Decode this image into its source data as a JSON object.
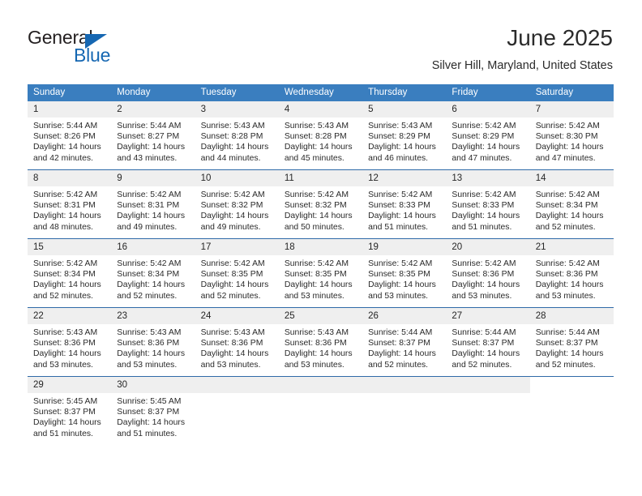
{
  "brand": {
    "name_top": "General",
    "name_bottom": "Blue",
    "accent_color": "#1667b2"
  },
  "header": {
    "title": "June 2025",
    "subtitle": "Silver Hill, Maryland, United States"
  },
  "calendar": {
    "header_background": "#3a7ebf",
    "daynum_background": "#efefef",
    "rule_color": "#2f6aa8",
    "weekday_headers": [
      "Sunday",
      "Monday",
      "Tuesday",
      "Wednesday",
      "Thursday",
      "Friday",
      "Saturday"
    ],
    "weeks": [
      [
        {
          "day": "1",
          "sunrise": "Sunrise: 5:44 AM",
          "sunset": "Sunset: 8:26 PM",
          "daylight_line1": "Daylight: 14 hours",
          "daylight_line2": "and 42 minutes."
        },
        {
          "day": "2",
          "sunrise": "Sunrise: 5:44 AM",
          "sunset": "Sunset: 8:27 PM",
          "daylight_line1": "Daylight: 14 hours",
          "daylight_line2": "and 43 minutes."
        },
        {
          "day": "3",
          "sunrise": "Sunrise: 5:43 AM",
          "sunset": "Sunset: 8:28 PM",
          "daylight_line1": "Daylight: 14 hours",
          "daylight_line2": "and 44 minutes."
        },
        {
          "day": "4",
          "sunrise": "Sunrise: 5:43 AM",
          "sunset": "Sunset: 8:28 PM",
          "daylight_line1": "Daylight: 14 hours",
          "daylight_line2": "and 45 minutes."
        },
        {
          "day": "5",
          "sunrise": "Sunrise: 5:43 AM",
          "sunset": "Sunset: 8:29 PM",
          "daylight_line1": "Daylight: 14 hours",
          "daylight_line2": "and 46 minutes."
        },
        {
          "day": "6",
          "sunrise": "Sunrise: 5:42 AM",
          "sunset": "Sunset: 8:29 PM",
          "daylight_line1": "Daylight: 14 hours",
          "daylight_line2": "and 47 minutes."
        },
        {
          "day": "7",
          "sunrise": "Sunrise: 5:42 AM",
          "sunset": "Sunset: 8:30 PM",
          "daylight_line1": "Daylight: 14 hours",
          "daylight_line2": "and 47 minutes."
        }
      ],
      [
        {
          "day": "8",
          "sunrise": "Sunrise: 5:42 AM",
          "sunset": "Sunset: 8:31 PM",
          "daylight_line1": "Daylight: 14 hours",
          "daylight_line2": "and 48 minutes."
        },
        {
          "day": "9",
          "sunrise": "Sunrise: 5:42 AM",
          "sunset": "Sunset: 8:31 PM",
          "daylight_line1": "Daylight: 14 hours",
          "daylight_line2": "and 49 minutes."
        },
        {
          "day": "10",
          "sunrise": "Sunrise: 5:42 AM",
          "sunset": "Sunset: 8:32 PM",
          "daylight_line1": "Daylight: 14 hours",
          "daylight_line2": "and 49 minutes."
        },
        {
          "day": "11",
          "sunrise": "Sunrise: 5:42 AM",
          "sunset": "Sunset: 8:32 PM",
          "daylight_line1": "Daylight: 14 hours",
          "daylight_line2": "and 50 minutes."
        },
        {
          "day": "12",
          "sunrise": "Sunrise: 5:42 AM",
          "sunset": "Sunset: 8:33 PM",
          "daylight_line1": "Daylight: 14 hours",
          "daylight_line2": "and 51 minutes."
        },
        {
          "day": "13",
          "sunrise": "Sunrise: 5:42 AM",
          "sunset": "Sunset: 8:33 PM",
          "daylight_line1": "Daylight: 14 hours",
          "daylight_line2": "and 51 minutes."
        },
        {
          "day": "14",
          "sunrise": "Sunrise: 5:42 AM",
          "sunset": "Sunset: 8:34 PM",
          "daylight_line1": "Daylight: 14 hours",
          "daylight_line2": "and 52 minutes."
        }
      ],
      [
        {
          "day": "15",
          "sunrise": "Sunrise: 5:42 AM",
          "sunset": "Sunset: 8:34 PM",
          "daylight_line1": "Daylight: 14 hours",
          "daylight_line2": "and 52 minutes."
        },
        {
          "day": "16",
          "sunrise": "Sunrise: 5:42 AM",
          "sunset": "Sunset: 8:34 PM",
          "daylight_line1": "Daylight: 14 hours",
          "daylight_line2": "and 52 minutes."
        },
        {
          "day": "17",
          "sunrise": "Sunrise: 5:42 AM",
          "sunset": "Sunset: 8:35 PM",
          "daylight_line1": "Daylight: 14 hours",
          "daylight_line2": "and 52 minutes."
        },
        {
          "day": "18",
          "sunrise": "Sunrise: 5:42 AM",
          "sunset": "Sunset: 8:35 PM",
          "daylight_line1": "Daylight: 14 hours",
          "daylight_line2": "and 53 minutes."
        },
        {
          "day": "19",
          "sunrise": "Sunrise: 5:42 AM",
          "sunset": "Sunset: 8:35 PM",
          "daylight_line1": "Daylight: 14 hours",
          "daylight_line2": "and 53 minutes."
        },
        {
          "day": "20",
          "sunrise": "Sunrise: 5:42 AM",
          "sunset": "Sunset: 8:36 PM",
          "daylight_line1": "Daylight: 14 hours",
          "daylight_line2": "and 53 minutes."
        },
        {
          "day": "21",
          "sunrise": "Sunrise: 5:42 AM",
          "sunset": "Sunset: 8:36 PM",
          "daylight_line1": "Daylight: 14 hours",
          "daylight_line2": "and 53 minutes."
        }
      ],
      [
        {
          "day": "22",
          "sunrise": "Sunrise: 5:43 AM",
          "sunset": "Sunset: 8:36 PM",
          "daylight_line1": "Daylight: 14 hours",
          "daylight_line2": "and 53 minutes."
        },
        {
          "day": "23",
          "sunrise": "Sunrise: 5:43 AM",
          "sunset": "Sunset: 8:36 PM",
          "daylight_line1": "Daylight: 14 hours",
          "daylight_line2": "and 53 minutes."
        },
        {
          "day": "24",
          "sunrise": "Sunrise: 5:43 AM",
          "sunset": "Sunset: 8:36 PM",
          "daylight_line1": "Daylight: 14 hours",
          "daylight_line2": "and 53 minutes."
        },
        {
          "day": "25",
          "sunrise": "Sunrise: 5:43 AM",
          "sunset": "Sunset: 8:36 PM",
          "daylight_line1": "Daylight: 14 hours",
          "daylight_line2": "and 53 minutes."
        },
        {
          "day": "26",
          "sunrise": "Sunrise: 5:44 AM",
          "sunset": "Sunset: 8:37 PM",
          "daylight_line1": "Daylight: 14 hours",
          "daylight_line2": "and 52 minutes."
        },
        {
          "day": "27",
          "sunrise": "Sunrise: 5:44 AM",
          "sunset": "Sunset: 8:37 PM",
          "daylight_line1": "Daylight: 14 hours",
          "daylight_line2": "and 52 minutes."
        },
        {
          "day": "28",
          "sunrise": "Sunrise: 5:44 AM",
          "sunset": "Sunset: 8:37 PM",
          "daylight_line1": "Daylight: 14 hours",
          "daylight_line2": "and 52 minutes."
        }
      ],
      [
        {
          "day": "29",
          "sunrise": "Sunrise: 5:45 AM",
          "sunset": "Sunset: 8:37 PM",
          "daylight_line1": "Daylight: 14 hours",
          "daylight_line2": "and 51 minutes."
        },
        {
          "day": "30",
          "sunrise": "Sunrise: 5:45 AM",
          "sunset": "Sunset: 8:37 PM",
          "daylight_line1": "Daylight: 14 hours",
          "daylight_line2": "and 51 minutes."
        },
        {
          "day": "",
          "sunrise": "",
          "sunset": "",
          "daylight_line1": "",
          "daylight_line2": ""
        },
        {
          "day": "",
          "sunrise": "",
          "sunset": "",
          "daylight_line1": "",
          "daylight_line2": ""
        },
        {
          "day": "",
          "sunrise": "",
          "sunset": "",
          "daylight_line1": "",
          "daylight_line2": ""
        },
        {
          "day": "",
          "sunrise": "",
          "sunset": "",
          "daylight_line1": "",
          "daylight_line2": ""
        },
        {
          "day": "",
          "sunrise": "",
          "sunset": "",
          "daylight_line1": "",
          "daylight_line2": ""
        }
      ]
    ]
  }
}
